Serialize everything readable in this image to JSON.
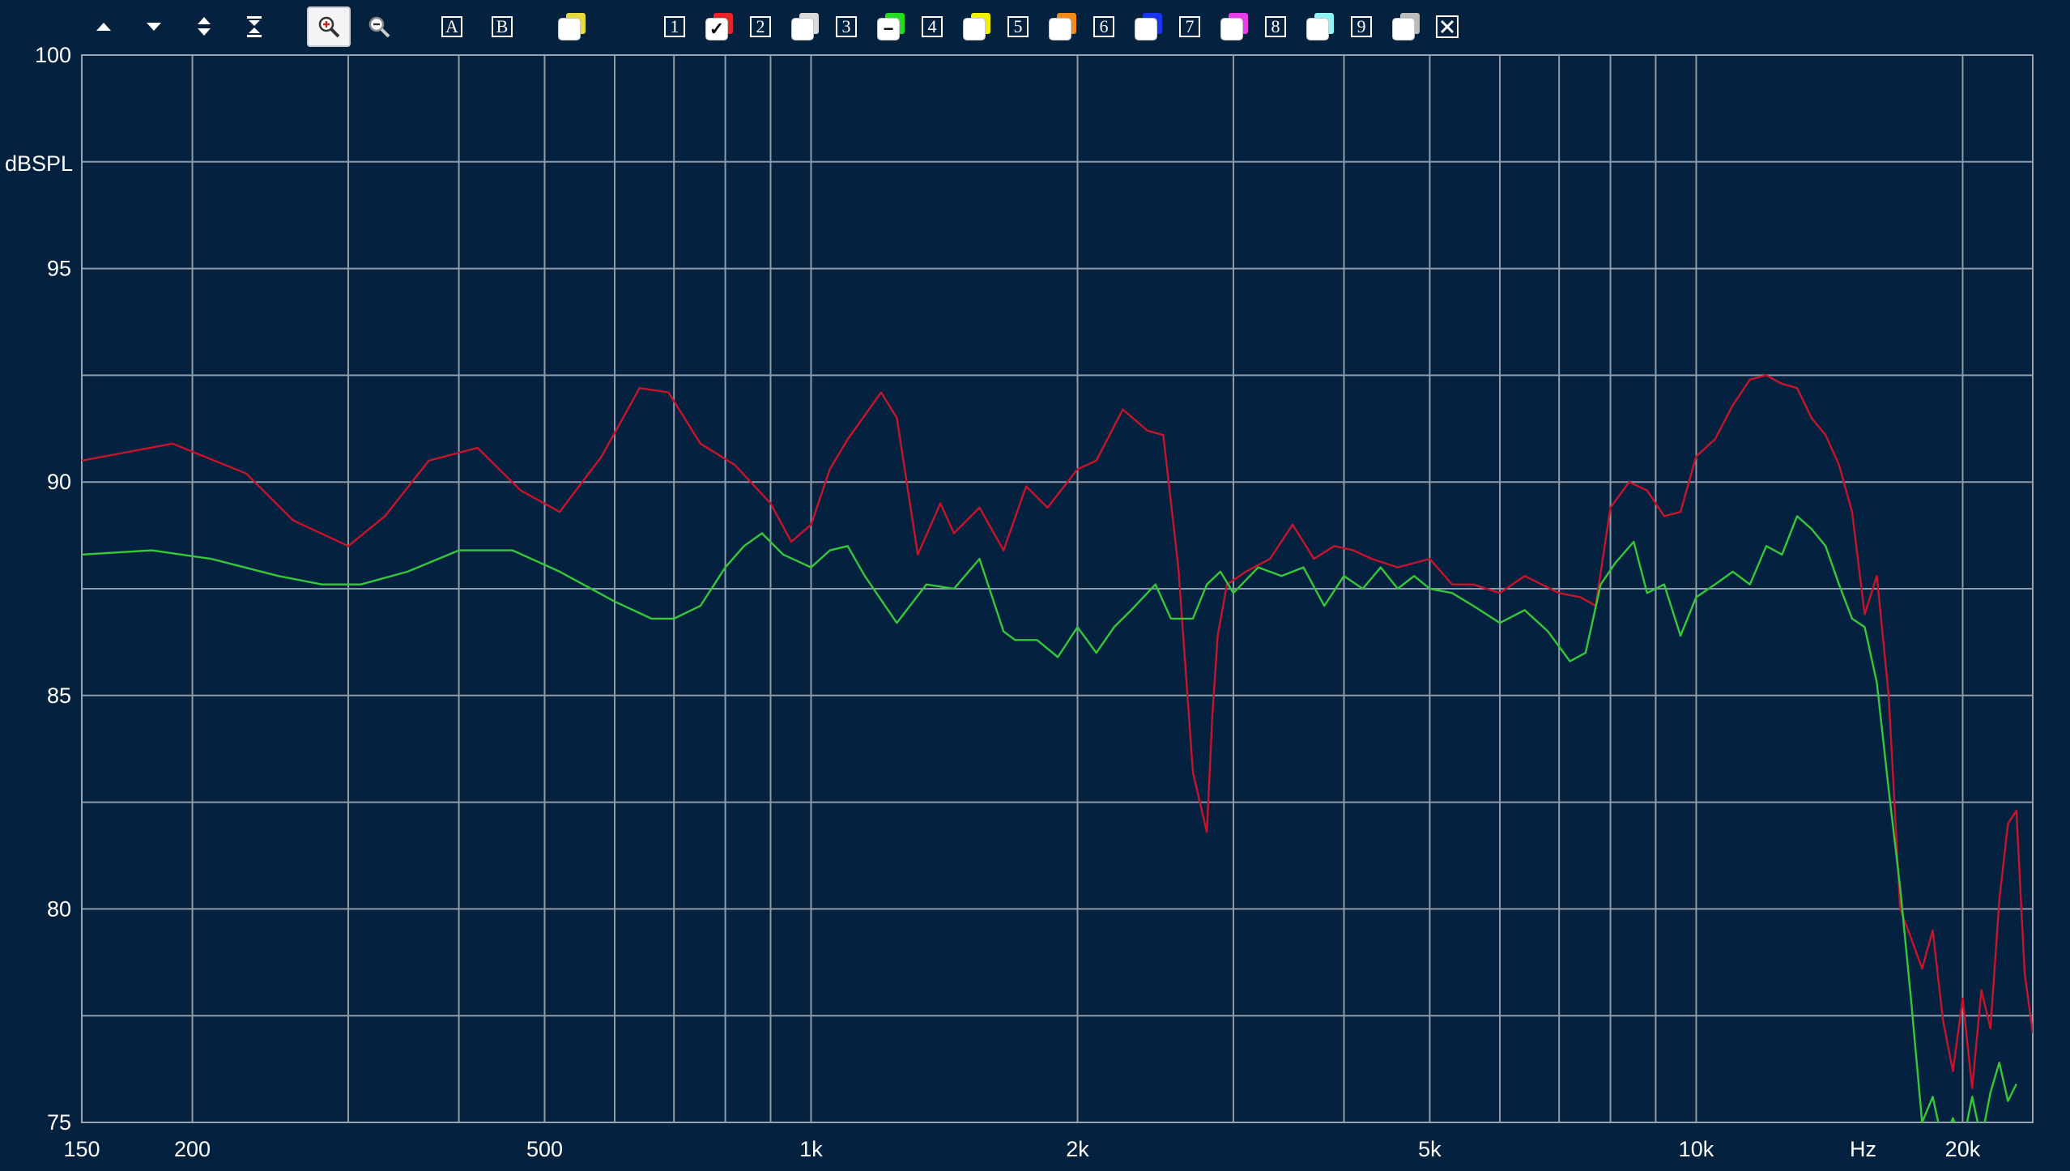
{
  "toolbar": {
    "nav_icons": [
      "arrow-up-icon",
      "arrow-down-icon",
      "expand-vertical-icon",
      "collapse-vertical-icon"
    ],
    "zoom_icons": [
      "zoom-in-icon",
      "zoom-out-icon"
    ],
    "ab_labels": [
      "A",
      "B"
    ],
    "close_icon": "close-icon",
    "traces": [
      {
        "label": "1",
        "color": "#e3242b",
        "state": "✓"
      },
      {
        "label": "2",
        "color": "#d9d9d9",
        "state": ""
      },
      {
        "label": "3",
        "color": "#22dd22",
        "state": "−"
      },
      {
        "label": "4",
        "color": "#f2f000",
        "state": ""
      },
      {
        "label": "5",
        "color": "#f08a1c",
        "state": ""
      },
      {
        "label": "6",
        "color": "#1536ee",
        "state": ""
      },
      {
        "label": "7",
        "color": "#e83ce8",
        "state": ""
      },
      {
        "label": "8",
        "color": "#8ff5f5",
        "state": ""
      },
      {
        "label": "9",
        "color": "#bcbcbc",
        "state": ""
      }
    ]
  },
  "chart_data": {
    "type": "line",
    "xscale": "log",
    "xlim": [
      150,
      24000
    ],
    "ylim": [
      75,
      100
    ],
    "ylabel": "dBSPL",
    "xunit": "Hz",
    "grid": true,
    "background": "#04223f",
    "x_tick_labels": [
      [
        150,
        "150"
      ],
      [
        200,
        "200"
      ],
      [
        500,
        "500"
      ],
      [
        1000,
        "1k"
      ],
      [
        2000,
        "2k"
      ],
      [
        5000,
        "5k"
      ],
      [
        10000,
        "10k"
      ],
      [
        20000,
        "20k"
      ]
    ],
    "x_grid": [
      200,
      300,
      400,
      500,
      600,
      700,
      800,
      900,
      1000,
      2000,
      3000,
      4000,
      5000,
      6000,
      7000,
      8000,
      9000,
      10000,
      20000
    ],
    "y_tick_labels": [
      [
        100,
        "100"
      ],
      [
        95,
        "95"
      ],
      [
        90,
        "90"
      ],
      [
        85,
        "85"
      ],
      [
        80,
        "80"
      ],
      [
        75,
        "75"
      ]
    ],
    "y_grid": [
      97.5,
      95,
      92.5,
      90,
      87.5,
      85,
      82.5,
      80,
      77.5
    ],
    "series": [
      {
        "color": "#c8142a",
        "x": [
          150,
          190,
          230,
          260,
          300,
          330,
          370,
          420,
          470,
          520,
          580,
          640,
          690,
          750,
          820,
          900,
          950,
          1000,
          1050,
          1100,
          1200,
          1250,
          1320,
          1400,
          1450,
          1550,
          1650,
          1750,
          1850,
          2000,
          2100,
          2250,
          2400,
          2500,
          2600,
          2700,
          2800,
          2840,
          2880,
          2950,
          3100,
          3300,
          3500,
          3700,
          3900,
          4100,
          4300,
          4600,
          5000,
          5300,
          5600,
          6000,
          6400,
          7000,
          7400,
          7700,
          8000,
          8400,
          8800,
          9200,
          9600,
          10000,
          10500,
          11000,
          11500,
          12000,
          12500,
          13000,
          13500,
          14000,
          14500,
          15000,
          15500,
          16000,
          16500,
          17000,
          17500,
          18000,
          18500,
          19000,
          19500,
          20000,
          20500,
          21000,
          21500,
          22000,
          22500,
          23000,
          23500,
          24000
        ],
        "y": [
          90.5,
          90.9,
          90.2,
          89.1,
          88.5,
          89.2,
          90.5,
          90.8,
          89.8,
          89.3,
          90.6,
          92.2,
          92.1,
          90.9,
          90.4,
          89.5,
          88.6,
          89.0,
          90.3,
          91.0,
          92.1,
          91.5,
          88.3,
          89.5,
          88.8,
          89.4,
          88.4,
          89.9,
          89.4,
          90.3,
          90.5,
          91.7,
          91.2,
          91.1,
          88.0,
          83.2,
          81.8,
          84.5,
          86.4,
          87.6,
          87.9,
          88.2,
          89.0,
          88.2,
          88.5,
          88.4,
          88.2,
          88.0,
          88.2,
          87.6,
          87.6,
          87.4,
          87.8,
          87.4,
          87.3,
          87.1,
          89.4,
          90.0,
          89.8,
          89.2,
          89.3,
          90.6,
          91.0,
          91.8,
          92.4,
          92.5,
          92.3,
          92.2,
          91.5,
          91.1,
          90.4,
          89.3,
          86.9,
          87.8,
          85.0,
          80.0,
          79.3,
          78.6,
          79.5,
          77.4,
          76.2,
          77.9,
          75.8,
          78.1,
          77.2,
          80.2,
          82.0,
          82.3,
          78.5,
          77.1
        ]
      },
      {
        "color": "#35c93a",
        "x": [
          150,
          180,
          210,
          250,
          280,
          310,
          350,
          400,
          460,
          520,
          600,
          660,
          700,
          750,
          800,
          840,
          880,
          930,
          1000,
          1050,
          1100,
          1150,
          1250,
          1350,
          1450,
          1550,
          1650,
          1700,
          1800,
          1900,
          2000,
          2100,
          2200,
          2300,
          2450,
          2550,
          2700,
          2800,
          2900,
          3000,
          3200,
          3400,
          3600,
          3800,
          4000,
          4200,
          4400,
          4600,
          4800,
          5000,
          5300,
          5600,
          6000,
          6400,
          6800,
          7200,
          7500,
          7800,
          8100,
          8500,
          8800,
          9200,
          9600,
          10000,
          10500,
          11000,
          11500,
          12000,
          12500,
          13000,
          13500,
          14000,
          14500,
          15000,
          15500,
          16000,
          16500,
          17000,
          17500,
          18000,
          18500,
          19000,
          19500,
          20000,
          20500,
          21000,
          21500,
          22000,
          22500,
          23000
        ],
        "y": [
          88.3,
          88.4,
          88.2,
          87.8,
          87.6,
          87.6,
          87.9,
          88.4,
          88.4,
          87.9,
          87.2,
          86.8,
          86.8,
          87.1,
          88.0,
          88.5,
          88.8,
          88.3,
          88.0,
          88.4,
          88.5,
          87.8,
          86.7,
          87.6,
          87.5,
          88.2,
          86.5,
          86.3,
          86.3,
          85.9,
          86.6,
          86.0,
          86.6,
          87.0,
          87.6,
          86.8,
          86.8,
          87.6,
          87.9,
          87.4,
          88.0,
          87.8,
          88.0,
          87.1,
          87.8,
          87.5,
          88.0,
          87.5,
          87.8,
          87.5,
          87.4,
          87.1,
          86.7,
          87.0,
          86.5,
          85.8,
          86.0,
          87.6,
          88.1,
          88.6,
          87.4,
          87.6,
          86.4,
          87.3,
          87.6,
          87.9,
          87.6,
          88.5,
          88.3,
          89.2,
          88.9,
          88.5,
          87.6,
          86.8,
          86.6,
          85.3,
          82.8,
          80.5,
          77.8,
          75.0,
          75.6,
          74.5,
          75.1,
          74.5,
          75.6,
          74.6,
          75.7,
          76.4,
          75.5,
          75.9
        ]
      }
    ]
  }
}
